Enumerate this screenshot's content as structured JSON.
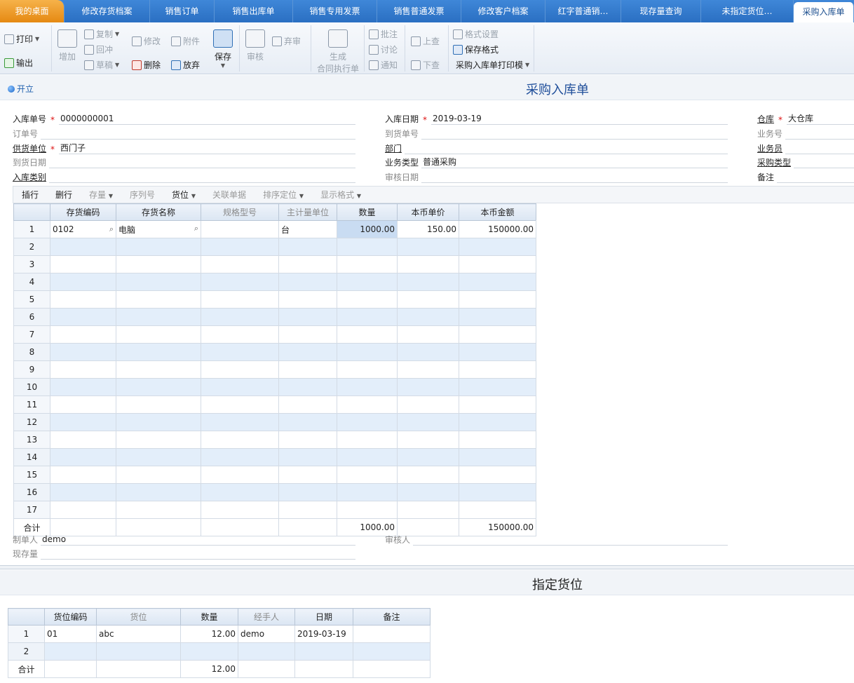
{
  "tabs": [
    {
      "label": "我的桌面",
      "kind": "home"
    },
    {
      "label": "修改存货档案",
      "kind": ""
    },
    {
      "label": "销售订单",
      "kind": ""
    },
    {
      "label": "销售出库单",
      "kind": ""
    },
    {
      "label": "销售专用发票",
      "kind": ""
    },
    {
      "label": "销售普通发票",
      "kind": ""
    },
    {
      "label": "修改客户档案",
      "kind": ""
    },
    {
      "label": "红字普通销…",
      "kind": ""
    },
    {
      "label": "现存量查询",
      "kind": ""
    },
    {
      "label": "未指定货位…",
      "kind": ""
    },
    {
      "label": "采购入库单",
      "kind": "active"
    }
  ],
  "toolbar": {
    "print": "打印",
    "export": "输出",
    "add": "增加",
    "copy": "复制",
    "redo": "回冲",
    "draft": "草稿",
    "modify": "修改",
    "attach": "附件",
    "delete": "删除",
    "abandon": "放弃",
    "save": "保存",
    "review": "审核",
    "unreview": "弃审",
    "generate_1": "生成",
    "generate_2": "合同执行单",
    "annotate": "批注",
    "discuss": "讨论",
    "notify": "通知",
    "prev": "上查",
    "next": "下查",
    "format_setting": "格式设置",
    "save_format": "保存格式",
    "print_template": "采购入库单打印模"
  },
  "status": "开立",
  "title": "采购入库单",
  "header": {
    "doc_no": {
      "label": "入库单号",
      "value": "0000000001"
    },
    "date": {
      "label": "入库日期",
      "value": "2019-03-19"
    },
    "warehouse": {
      "label": "仓库",
      "value": "大仓库"
    },
    "order_no": {
      "label": "订单号",
      "value": ""
    },
    "arrival_no": {
      "label": "到货单号",
      "value": ""
    },
    "business_no": {
      "label": "业务号",
      "value": ""
    },
    "supplier": {
      "label": "供货单位",
      "value": "西门子"
    },
    "dept": {
      "label": "部门",
      "value": ""
    },
    "clerk": {
      "label": "业务员",
      "value": ""
    },
    "arrival_date": {
      "label": "到货日期",
      "value": ""
    },
    "biz_type": {
      "label": "业务类型",
      "value": "普通采购"
    },
    "purchase_type": {
      "label": "采购类型",
      "value": ""
    },
    "in_type": {
      "label": "入库类别",
      "value": ""
    },
    "audit_date": {
      "label": "审核日期",
      "value": ""
    },
    "remark": {
      "label": "备注",
      "value": ""
    }
  },
  "grid_toolbar": {
    "insert": "插行",
    "delete": "删行",
    "stock": "存量",
    "serial": "序列号",
    "location": "货位",
    "link": "关联单据",
    "sort": "排序定位",
    "display": "显示格式"
  },
  "grid": {
    "columns": [
      "存货编码",
      "存货名称",
      "规格型号",
      "主计量单位",
      "数量",
      "本币单价",
      "本币金额"
    ],
    "rows": [
      {
        "n": "1",
        "code": "0102",
        "name": "电脑",
        "spec": "",
        "unit": "台",
        "qty": "1000.00",
        "price": "150.00",
        "amount": "150000.00"
      },
      {
        "n": "2"
      },
      {
        "n": "3"
      },
      {
        "n": "4"
      },
      {
        "n": "5"
      },
      {
        "n": "6"
      },
      {
        "n": "7"
      },
      {
        "n": "8"
      },
      {
        "n": "9"
      },
      {
        "n": "10"
      },
      {
        "n": "11"
      },
      {
        "n": "12"
      },
      {
        "n": "13"
      },
      {
        "n": "14"
      },
      {
        "n": "15"
      },
      {
        "n": "16"
      },
      {
        "n": "17"
      }
    ],
    "total_label": "合计",
    "total_qty": "1000.00",
    "total_amount": "150000.00"
  },
  "footer": {
    "maker": {
      "label": "制单人",
      "value": "demo"
    },
    "auditor": {
      "label": "审核人",
      "value": ""
    },
    "stock": {
      "label": "现存量",
      "value": ""
    }
  },
  "sub_title": "指定货位",
  "sub_grid": {
    "columns": [
      "货位编码",
      "货位",
      "数量",
      "经手人",
      "日期",
      "备注"
    ],
    "rows": [
      {
        "n": "1",
        "code": "01",
        "loc": "abc",
        "qty": "12.00",
        "handler": "demo",
        "date": "2019-03-19",
        "remark": ""
      },
      {
        "n": "2"
      }
    ],
    "total_label": "合计",
    "total_qty": "12.00"
  }
}
